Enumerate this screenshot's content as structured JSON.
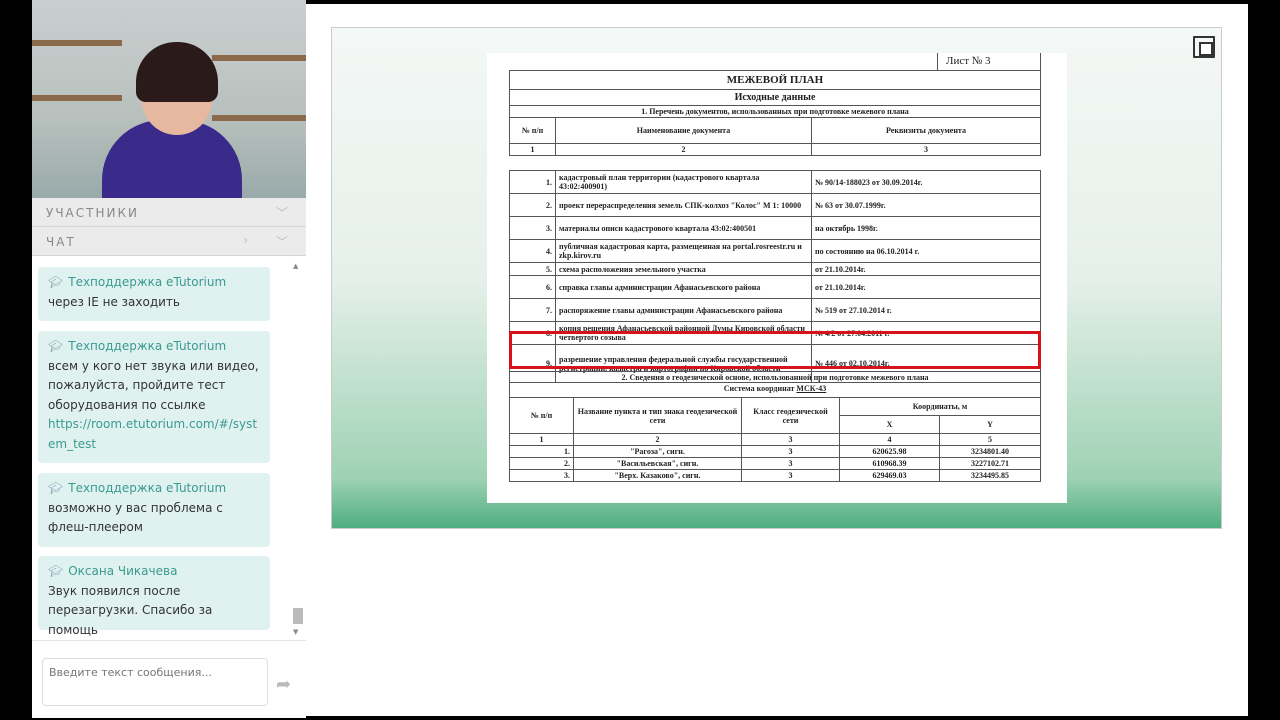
{
  "sidebar": {
    "participants_label": "УЧАСТНИКИ",
    "chat_label": "ЧАТ",
    "messages": [
      {
        "author": "Техподдержка eTutorium",
        "text": "через IE не заходить"
      },
      {
        "author": "Техподдержка eTutorium",
        "text": "всем у кого нет звука или видео, пожалуйста, пройдите тест оборудования по ссылке",
        "link": "https://room.etutorium.com/#/system_test"
      },
      {
        "author": "Техподдержка eTutorium",
        "text": "возможно у вас проблема с флеш-плеером"
      },
      {
        "author": "Оксана Чикачева",
        "text": "Звук появился после перезагрузки. Спасибо за помощь"
      }
    ],
    "input_placeholder": "Введите текст сообщения..."
  },
  "document": {
    "sheet": "Лист № 3",
    "title": "МЕЖЕВОЙ ПЛАН",
    "subtitle": "Исходные данные",
    "section1": "1. Перечень документов, использованных при подготовке межевого плана",
    "t1_headers": [
      "№ п/п",
      "Наименование документа",
      "Реквизиты документа"
    ],
    "t1_nums": [
      "1",
      "2",
      "3"
    ],
    "t1_rows": [
      [
        "1.",
        "кадастровый план территории (кадастрового квартала 43:02:400901)",
        "№ 90/14-188023 от 30.09.2014г."
      ],
      [
        "2.",
        "проект перераспределения земель СПК-колхоз \"Колос\"   М 1: 10000",
        "№ 63 от 30.07.1999г."
      ],
      [
        "3.",
        "материалы описи кадастрового квартала 43:02:400501",
        "на октябрь 1998г."
      ],
      [
        "4.",
        "публичная кадастровая карта, размещенная на portal.rosreestr.ru  и zkp.kirov.ru",
        "по состоянию на 06.10.2014 г."
      ],
      [
        "5.",
        "схема расположения земельного участка",
        "от 21.10.2014г."
      ],
      [
        "6.",
        "справка главы администрации Афанасьевского района",
        "от 21.10.2014г."
      ],
      [
        "7.",
        "распоряжение  главы администрации Афанасьевского района",
        "№ 519    от 27.10.2014 г."
      ],
      [
        "8.",
        "копия решения Афанасьевской районной Думы Кировской области четвертого созыва",
        "№ 4/2  от 27.04.2011 г."
      ],
      [
        "9.",
        "разрешение управления федеральной службы государственной регистрации, кадастра и картографии по Кировской области",
        "№ 446 от 02.10.2014г."
      ]
    ],
    "section2": "2. Сведения о геодезической основе, использованной при подготовке межевого плана",
    "coord_system_label": "Система координат",
    "coord_system": "МСК-43",
    "t2_headers": [
      "№ п/п",
      "Название пункта и тип знака геодезической сети",
      "Класс геодезической сети",
      "Координаты, м",
      "X",
      "Y"
    ],
    "t2_nums": [
      "1",
      "2",
      "3",
      "4",
      "5"
    ],
    "t2_rows": [
      [
        "1.",
        "\"Рагоза\", сигн.",
        "3",
        "620625.98",
        "3234801.40"
      ],
      [
        "2.",
        "\"Васильевская\", сигн.",
        "3",
        "610968.39",
        "3227102.71"
      ],
      [
        "3.",
        "\"Верх. Казаково\", сигн.",
        "3",
        "629469.03",
        "3234495.85"
      ]
    ]
  },
  "colors": {
    "highlight": "#d8121b",
    "accent": "#3a9a90",
    "chat_bubble": "#e0f2f0"
  }
}
